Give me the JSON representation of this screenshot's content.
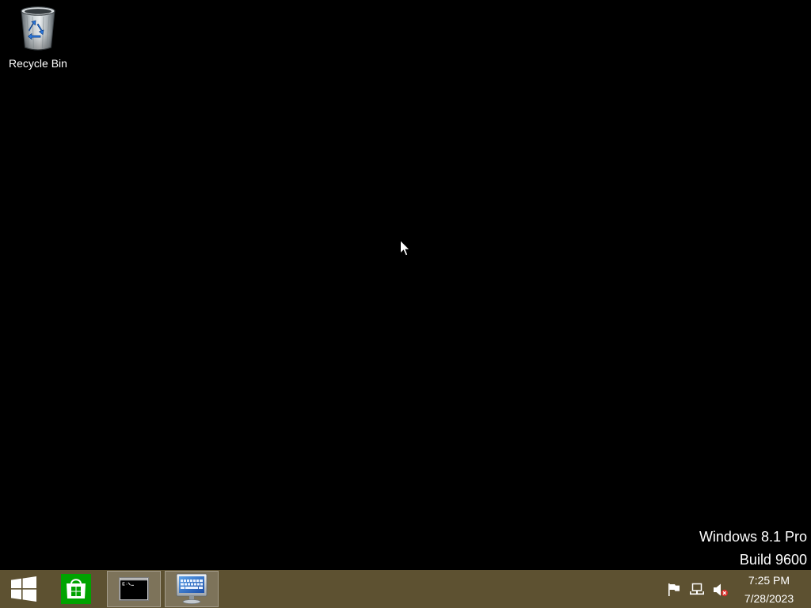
{
  "desktop": {
    "background_color": "#000000",
    "icons": [
      {
        "label": "Recycle Bin",
        "icon": "recycle-bin-icon"
      }
    ],
    "watermark": {
      "edition": "Windows 8.1 Pro",
      "build": "Build 9600"
    }
  },
  "cursor": {
    "icon": "mouse-pointer-icon"
  },
  "taskbar": {
    "color": "#5d5131",
    "start_button": {
      "icon": "windows-logo-icon"
    },
    "buttons": [
      {
        "app_icon": "windows-store-icon",
        "active": false
      },
      {
        "app_icon": "command-prompt-icon",
        "active": true
      },
      {
        "app_icon": "on-screen-keyboard-icon",
        "active": true
      }
    ],
    "tray": {
      "icons": [
        "action-center-flag-icon",
        "network-icon",
        "volume-muted-icon"
      ],
      "clock": {
        "time": "7:25 PM",
        "date": "7/28/2023"
      }
    }
  },
  "colors": {
    "store_tile": "#00a300",
    "mute_badge": "#d9302c"
  }
}
